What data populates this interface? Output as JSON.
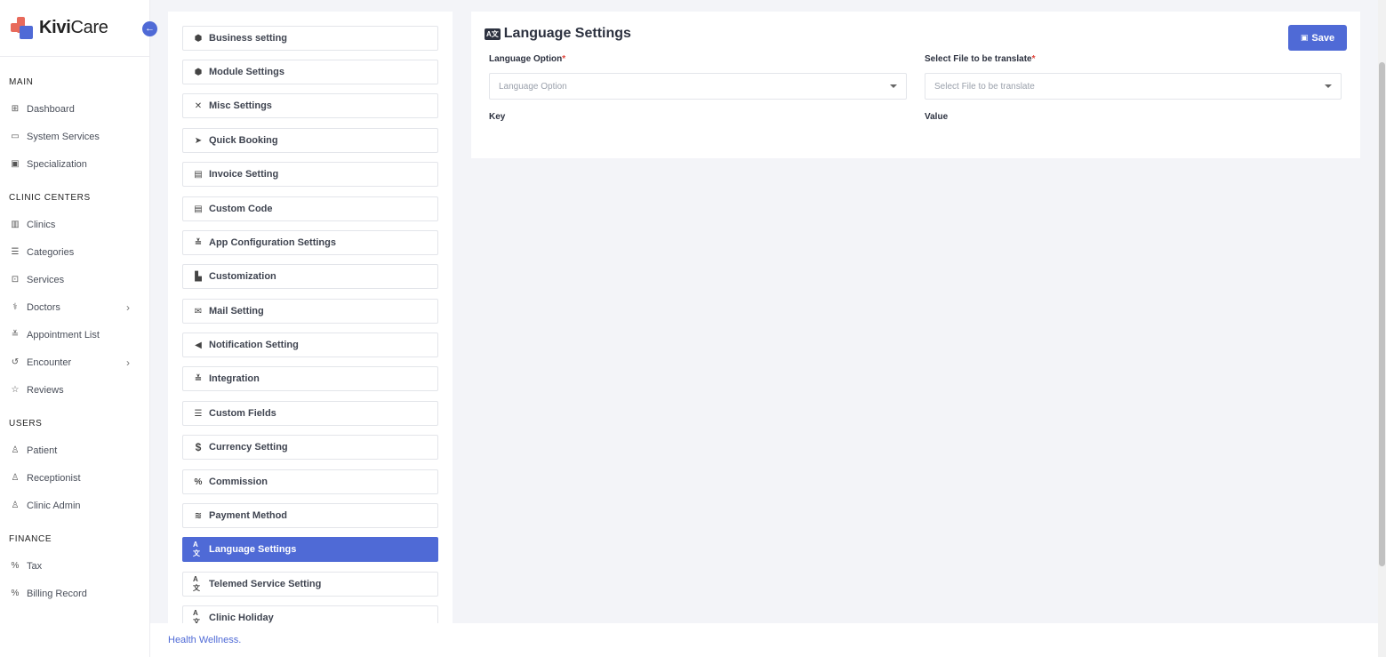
{
  "app": {
    "logo_bold": "Kivi",
    "logo_rest": "Care"
  },
  "sidebar": {
    "sections": [
      {
        "title": "MAIN",
        "items": [
          {
            "label": "Dashboard",
            "icon": "grid-icon"
          },
          {
            "label": "System Services",
            "icon": "monitor-icon"
          },
          {
            "label": "Specialization",
            "icon": "clipboard-icon"
          }
        ]
      },
      {
        "title": "CLINIC CENTERS",
        "items": [
          {
            "label": "Clinics",
            "icon": "building-icon"
          },
          {
            "label": "Categories",
            "icon": "list-icon"
          },
          {
            "label": "Services",
            "icon": "medical-kit-icon"
          },
          {
            "label": "Doctors",
            "icon": "stethoscope-icon",
            "has_children": true
          },
          {
            "label": "Appointment List",
            "icon": "sliders-icon"
          },
          {
            "label": "Encounter",
            "icon": "history-icon",
            "has_children": true
          },
          {
            "label": "Reviews",
            "icon": "star-icon"
          }
        ]
      },
      {
        "title": "USERS",
        "items": [
          {
            "label": "Patient",
            "icon": "user-icon"
          },
          {
            "label": "Receptionist",
            "icon": "user-icon"
          },
          {
            "label": "Clinic Admin",
            "icon": "user-icon"
          }
        ]
      },
      {
        "title": "FINANCE",
        "items": [
          {
            "label": "Tax",
            "icon": "percent-icon"
          },
          {
            "label": "Billing Record",
            "icon": "percent-icon"
          }
        ]
      }
    ]
  },
  "settings_menu": {
    "items": [
      {
        "label": "Business setting",
        "icon": "cube-icon"
      },
      {
        "label": "Module Settings",
        "icon": "cube-icon"
      },
      {
        "label": "Misc Settings",
        "icon": "tools-icon"
      },
      {
        "label": "Quick Booking",
        "icon": "paper-plane-icon"
      },
      {
        "label": "Invoice Setting",
        "icon": "file-icon"
      },
      {
        "label": "Custom Code",
        "icon": "code-file-icon"
      },
      {
        "label": "App Configuration Settings",
        "icon": "sliders-icon"
      },
      {
        "label": "Customization",
        "icon": "palette-icon"
      },
      {
        "label": "Mail Setting",
        "icon": "envelope-icon"
      },
      {
        "label": "Notification Setting",
        "icon": "megaphone-icon"
      },
      {
        "label": "Integration",
        "icon": "sliders-icon"
      },
      {
        "label": "Custom Fields",
        "icon": "bars-icon"
      },
      {
        "label": "Currency Setting",
        "icon": "dollar-icon"
      },
      {
        "label": "Commission",
        "icon": "percent-icon"
      },
      {
        "label": "Payment Method",
        "icon": "coins-icon"
      },
      {
        "label": "Language Settings",
        "icon": "language-icon",
        "active": true
      },
      {
        "label": "Telemed Service Setting",
        "icon": "language-icon"
      },
      {
        "label": "Clinic Holiday",
        "icon": "language-icon"
      }
    ]
  },
  "content": {
    "title": "Language Settings",
    "title_icon_text": "A文",
    "save_label": "Save",
    "language_option": {
      "label": "Language Option",
      "required_mark": "*",
      "placeholder": "Language Option"
    },
    "file_select": {
      "label": "Select File to be translate",
      "required_mark": "*",
      "placeholder": "Select File to be translate"
    },
    "key_header": "Key",
    "value_header": "Value"
  },
  "footer": {
    "text": "Health Wellness."
  },
  "colors": {
    "accent": "#4f6ad6",
    "required": "#e0443b",
    "background": "#f3f4f8"
  }
}
